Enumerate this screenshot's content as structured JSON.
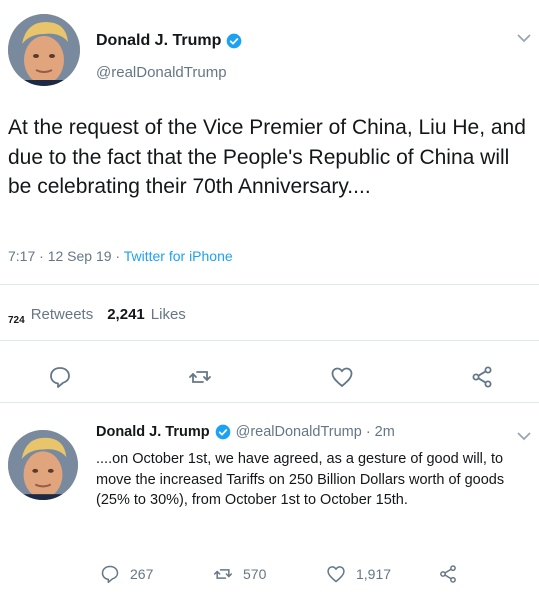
{
  "tweet1": {
    "name": "Donald J. Trump",
    "handle": "@realDonaldTrump",
    "text": "At the request of the Vice Premier of China, Liu He, and due to the fact that the People's Republic of China will be celebrating their 70th Anniversary....",
    "time_date": "7:17 · 12 Sep 19 · ",
    "source": "Twitter for iPhone",
    "retweets_count": "724",
    "retweets_label": "Retweets",
    "likes_count": "2,241",
    "likes_label": "Likes",
    "icons": [
      "reply-icon",
      "retweet-icon",
      "like-icon",
      "share-icon"
    ]
  },
  "tweet2": {
    "name": "Donald J. Trump",
    "handle": "@realDonaldTrump · 2m",
    "text": "....on October 1st, we have agreed, as a gesture of good will, to move the increased Tariffs on 250 Billion Dollars worth of goods (25% to 30%), from October 1st to October 15th.",
    "replies": "267",
    "retweets": "570",
    "likes": "1,917"
  },
  "colors": {
    "twitter_blue": "#1da1f2",
    "text": "#14171a",
    "muted": "#657786",
    "divider": "#e1e8ed"
  }
}
